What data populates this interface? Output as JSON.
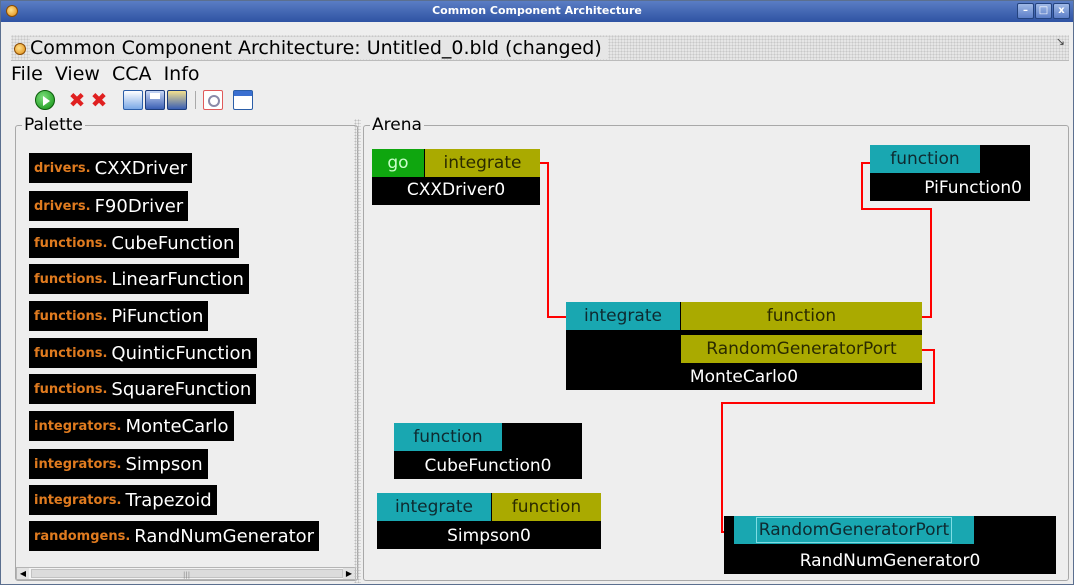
{
  "window": {
    "os_title": "Common Component Architecture",
    "frame_title": "Common Component Architecture: Untitled_0.bld (changed)",
    "buttons": {
      "minimize": "–",
      "maximize": "□",
      "close": "x"
    }
  },
  "menu": {
    "items": [
      "File",
      "View",
      "CCA",
      "Info"
    ]
  },
  "toolbar": {
    "icons": [
      "go-icon",
      "remove-icon",
      "remove-all-icon",
      "open-file-icon",
      "save-icon",
      "save-as-icon",
      "preview-icon",
      "window-icon"
    ]
  },
  "palette": {
    "title": "Palette",
    "items": [
      {
        "pkg": "drivers.",
        "name": "CXXDriver"
      },
      {
        "pkg": "drivers.",
        "name": "F90Driver"
      },
      {
        "pkg": "functions.",
        "name": "CubeFunction"
      },
      {
        "pkg": "functions.",
        "name": "LinearFunction"
      },
      {
        "pkg": "functions.",
        "name": "PiFunction"
      },
      {
        "pkg": "functions.",
        "name": "QuinticFunction"
      },
      {
        "pkg": "functions.",
        "name": "SquareFunction"
      },
      {
        "pkg": "integrators.",
        "name": "MonteCarlo"
      },
      {
        "pkg": "integrators.",
        "name": "Simpson"
      },
      {
        "pkg": "integrators.",
        "name": "Trapezoid"
      },
      {
        "pkg": "randomgens.",
        "name": "RandNumGenerator"
      }
    ]
  },
  "arena": {
    "title": "Arena",
    "components": {
      "cxxdriver": {
        "name": "CXXDriver0",
        "go": "go",
        "uses": "integrate"
      },
      "pifunction": {
        "name": "PiFunction0",
        "provides": "function"
      },
      "montecarlo": {
        "name": "MonteCarlo0",
        "provides": "integrate",
        "uses1": "function",
        "uses2": "RandomGeneratorPort"
      },
      "cubefunction": {
        "name": "CubeFunction0",
        "provides": "function"
      },
      "simpson": {
        "name": "Simpson0",
        "provides": "integrate",
        "uses": "function"
      },
      "randnumgen": {
        "name": "RandNumGenerator0",
        "provides": "RandomGeneratorPort"
      }
    }
  },
  "colors": {
    "go_port": "#0fa60f",
    "uses_port": "#aaaa00",
    "provides_port": "#19a7b1",
    "wire": "#ff0000",
    "package_label": "#e07b1f"
  }
}
